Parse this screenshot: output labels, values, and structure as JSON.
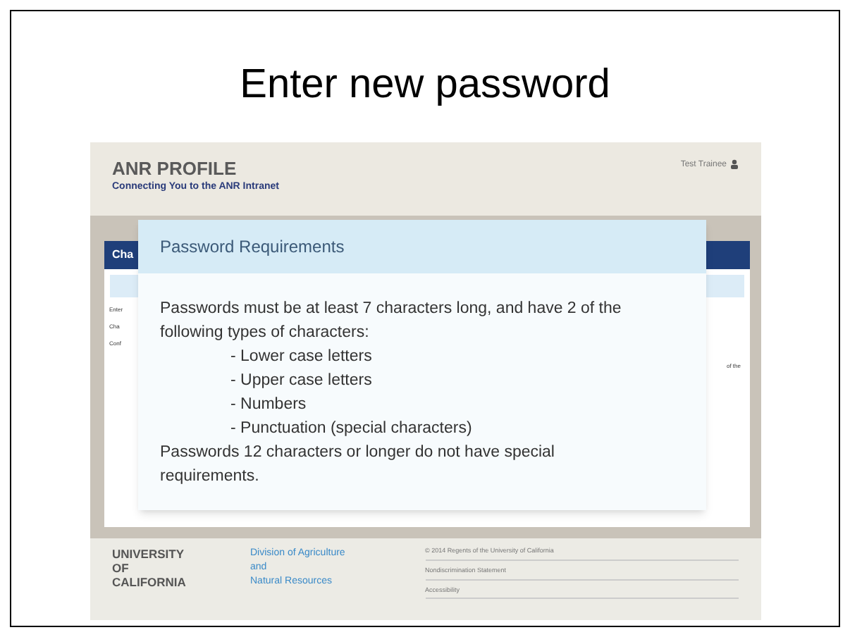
{
  "slide_title": "Enter new password",
  "screenshot": {
    "header": {
      "title": "ANR PROFILE",
      "subtitle": "Connecting You to the ANR Intranet",
      "user": "Test Trainee"
    },
    "background_form": {
      "panel_title": "Cha",
      "fragments": [
        "Enter",
        "Cha",
        "Conf"
      ],
      "side_note": "of the"
    },
    "dialog": {
      "title": "Password Requirements",
      "intro": "Passwords must be at least 7 characters long, and have 2 of the following types of characters:",
      "items": [
        "- Lower case letters",
        "- Upper case letters",
        "- Numbers",
        "- Punctuation (special characters)"
      ],
      "note": "Passwords 12 characters or longer do not have special requirements."
    },
    "footer": {
      "university": [
        "UNIVERSITY",
        "OF",
        "CALIFORNIA"
      ],
      "division": [
        "Division of Agriculture",
        "and",
        "Natural Resources"
      ],
      "links": [
        "© 2014 Regents of the University of California",
        "Nondiscrimination Statement",
        "Accessibility"
      ]
    }
  }
}
